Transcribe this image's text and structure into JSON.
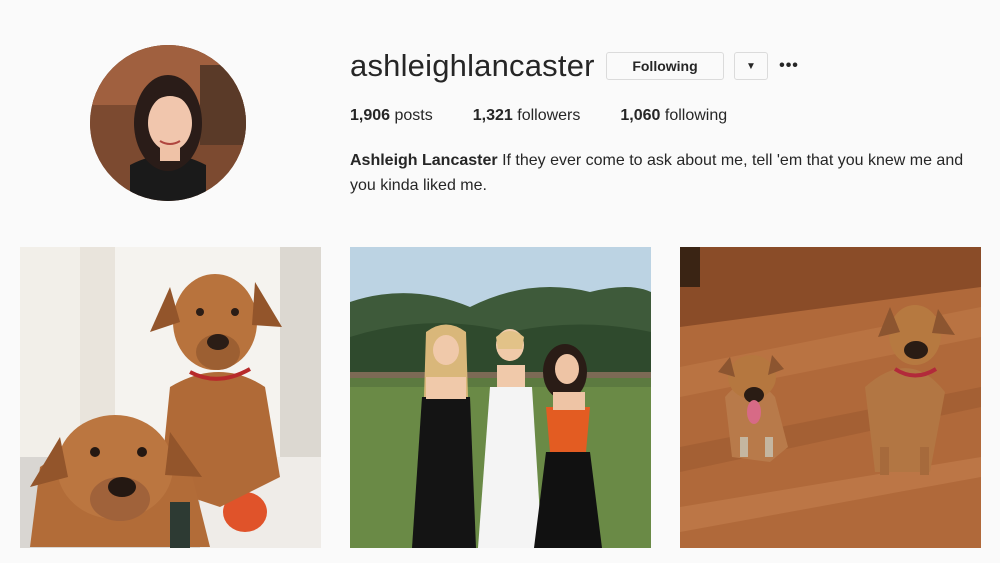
{
  "profile": {
    "username": "ashleighlancaster",
    "following_button": "Following",
    "dropdown_icon": "caret-down-icon",
    "more_icon": "more-options-icon",
    "stats": {
      "posts_count": "1,906",
      "posts_label": "posts",
      "followers_count": "1,321",
      "followers_label": "followers",
      "following_count": "1,060",
      "following_label": "following"
    },
    "bio": {
      "full_name": "Ashleigh Lancaster",
      "text": "If they ever come to ask about me, tell 'em that you knew me and you kinda liked me."
    }
  },
  "posts": [
    {
      "subject": "two dogs close-up"
    },
    {
      "subject": "three women at wedding outdoors"
    },
    {
      "subject": "two dogs on wooden floor"
    }
  ],
  "colors": {
    "background": "#fafafa",
    "text": "#262626",
    "border": "#dbdbdb"
  }
}
